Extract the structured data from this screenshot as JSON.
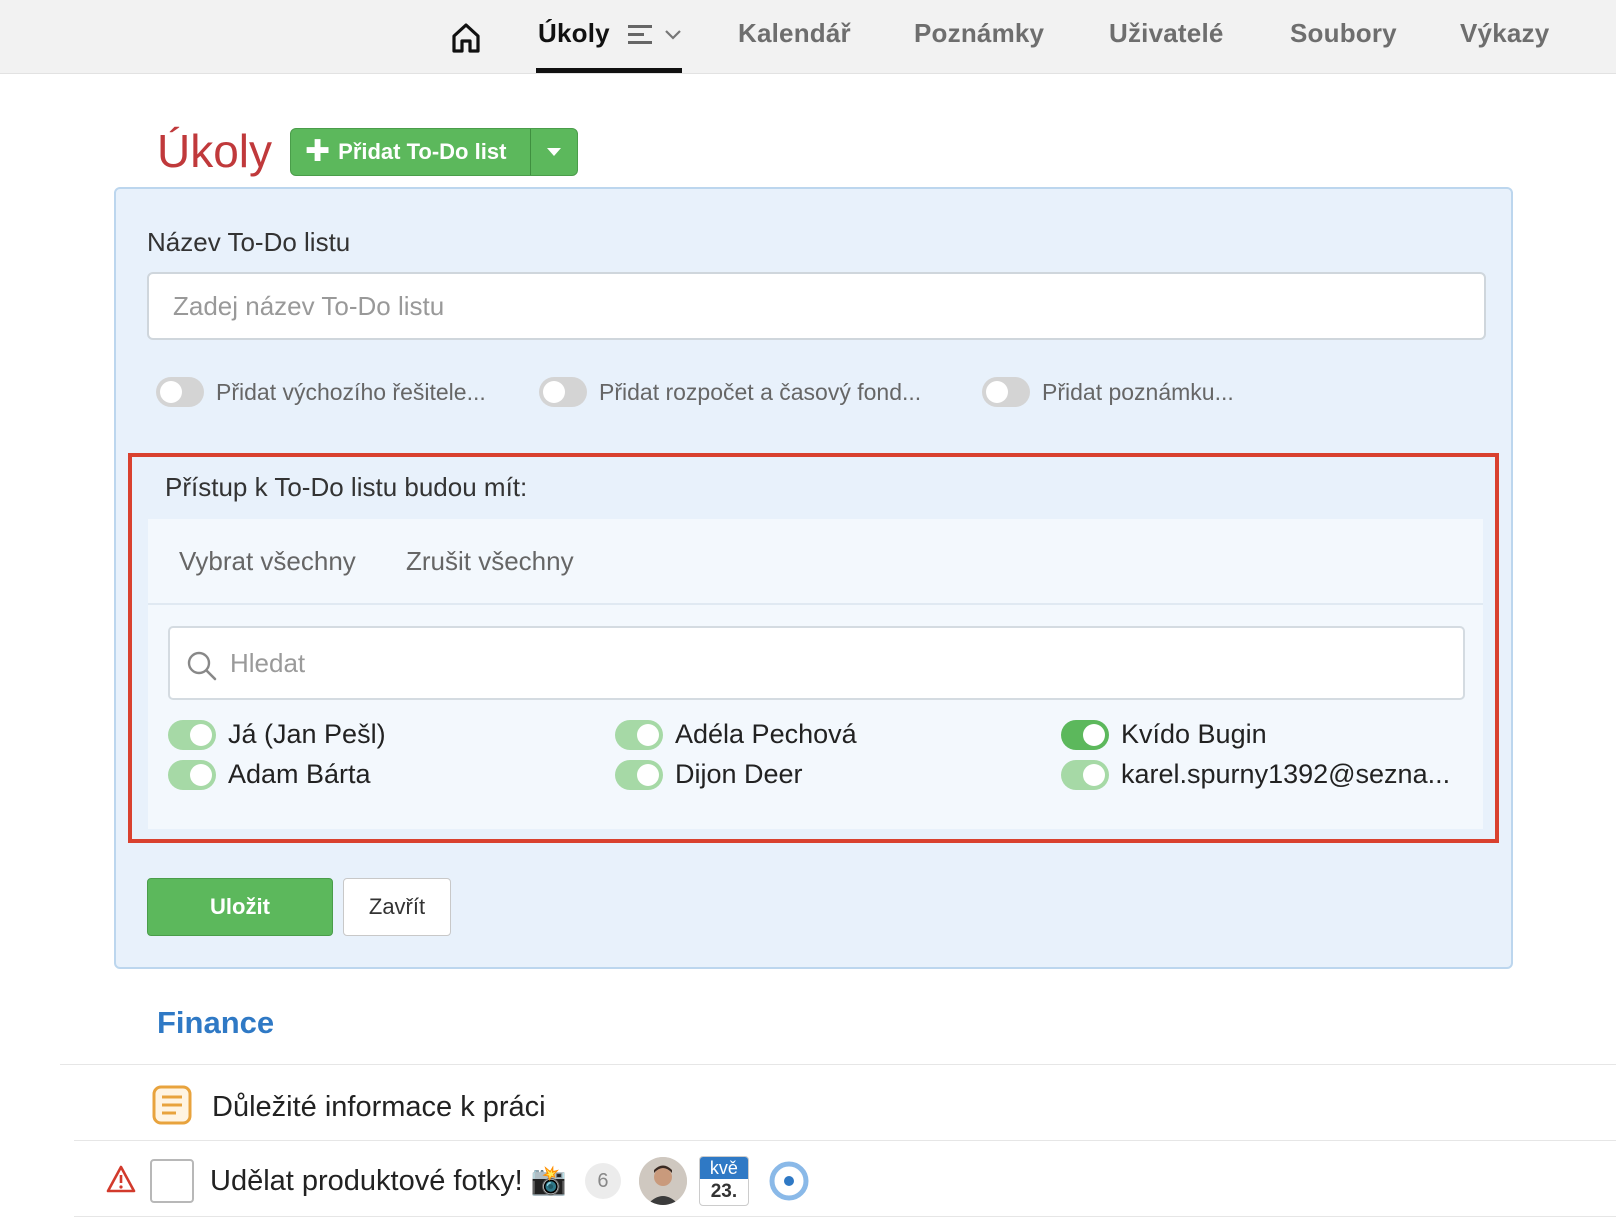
{
  "nav": {
    "tabs": [
      {
        "label": "Úkoly"
      },
      {
        "label": "Kalendář"
      },
      {
        "label": "Poznámky"
      },
      {
        "label": "Uživatelé"
      },
      {
        "label": "Soubory"
      },
      {
        "label": "Výkazy"
      }
    ],
    "active_tab": "Úkoly"
  },
  "page": {
    "title": "Úkoly",
    "add_button_label": "Přidat To-Do list"
  },
  "form": {
    "name_label": "Název To-Do listu",
    "name_placeholder": "Zadej název To-Do listu",
    "name_value": "",
    "options": [
      {
        "label": "Přidat výchozího řešitele...",
        "on": false
      },
      {
        "label": "Přidat rozpočet a časový fond...",
        "on": false
      },
      {
        "label": "Přidat poznámku...",
        "on": false
      }
    ],
    "access": {
      "title": "Přístup k To-Do listu budou mít:",
      "select_all": "Vybrat všechny",
      "clear_all": "Zrušit všechny",
      "search_placeholder": "Hledat",
      "users": [
        {
          "name": "Já (Jan Pešl)",
          "on": true
        },
        {
          "name": "Adam Bárta",
          "on": true
        },
        {
          "name": "Adéla Pechová",
          "on": true
        },
        {
          "name": "Dijon Deer",
          "on": true
        },
        {
          "name": "Kvído Bugin",
          "on": true
        },
        {
          "name": "karel.spurny1392@sezna...",
          "on": true
        }
      ]
    },
    "save_label": "Uložit",
    "close_label": "Zavřít"
  },
  "lists": {
    "section_title": "Finance",
    "note_item": "Důležité informace k práci",
    "task": {
      "title": "Udělat produktové fotky! 📸",
      "count": "6",
      "date_month": "kvě",
      "date_day": "23."
    }
  },
  "colors": {
    "title_red": "#c0393b",
    "accent_green": "#5cb85c",
    "link_blue": "#2f79c5",
    "highlight_red": "#d9412f",
    "panel_bg": "#e8f1fb"
  },
  "icons": [
    "home-icon",
    "list-icon",
    "chevron-down-icon",
    "plus-icon",
    "caret-down-icon",
    "search-icon",
    "note-icon",
    "warning-icon",
    "status-circle-icon"
  ]
}
